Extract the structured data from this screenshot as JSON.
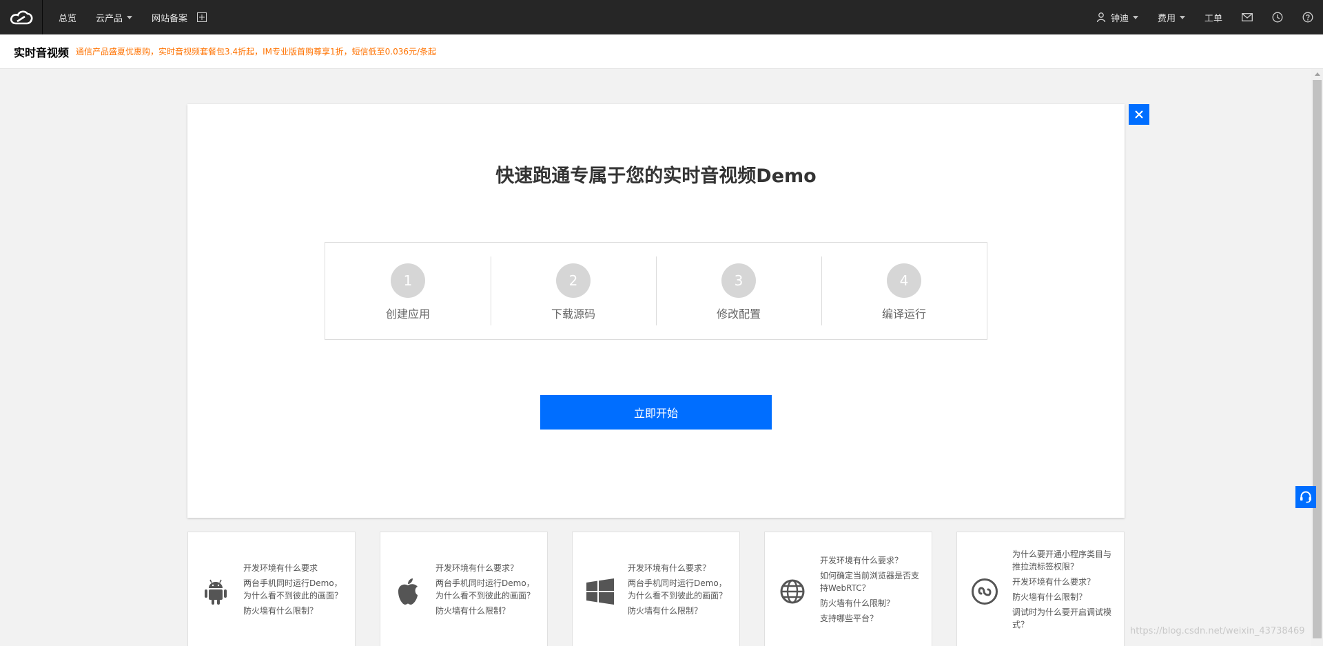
{
  "topbar": {
    "logo_icon": "cloud-logo-icon",
    "nav": [
      {
        "label": "总览"
      },
      {
        "label": "云产品"
      },
      {
        "label": "网站备案"
      }
    ],
    "user": "钟迪",
    "billing": "费用",
    "ticket": "工单"
  },
  "subheader": {
    "title": "实时音视频",
    "promo": "通信产品盛夏优惠购，实时音视频套餐包3.4折起，IM专业版首购尊享1折，短信低至0.036元/条起"
  },
  "main": {
    "heading": "快速跑通专属于您的实时音视频Demo",
    "steps": [
      {
        "num": "1",
        "label": "创建应用"
      },
      {
        "num": "2",
        "label": "下载源码"
      },
      {
        "num": "3",
        "label": "修改配置"
      },
      {
        "num": "4",
        "label": "编译运行"
      }
    ],
    "start_button": "立即开始"
  },
  "faq_cards": [
    {
      "icon": "android-icon",
      "links": [
        "开发环境有什么要求",
        "两台手机同时运行Demo，为什么看不到彼此的画面？",
        "防火墙有什么限制？"
      ]
    },
    {
      "icon": "apple-icon",
      "links": [
        "开发环境有什么要求？",
        "两台手机同时运行Demo，为什么看不到彼此的画面？",
        "防火墙有什么限制？"
      ]
    },
    {
      "icon": "windows-icon",
      "links": [
        "开发环境有什么要求？",
        "两台手机同时运行Demo，为什么看不到彼此的画面？",
        "防火墙有什么限制？"
      ]
    },
    {
      "icon": "globe-icon",
      "links": [
        "开发环境有什么要求？",
        "如何确定当前浏览器是否支持WebRTC？",
        "防火墙有什么限制？",
        "支持哪些平台？"
      ]
    },
    {
      "icon": "mini-program-icon",
      "links": [
        "为什么要开通小程序类目与推拉流标签权限？",
        "开发环境有什么要求？",
        "防火墙有什么限制？",
        "调试时为什么要开启调试模式？"
      ]
    }
  ],
  "watermark": "https://blog.csdn.net/weixin_43738469",
  "colors": {
    "accent": "#006eff",
    "topbar": "#262626",
    "promo": "#ff7200"
  }
}
